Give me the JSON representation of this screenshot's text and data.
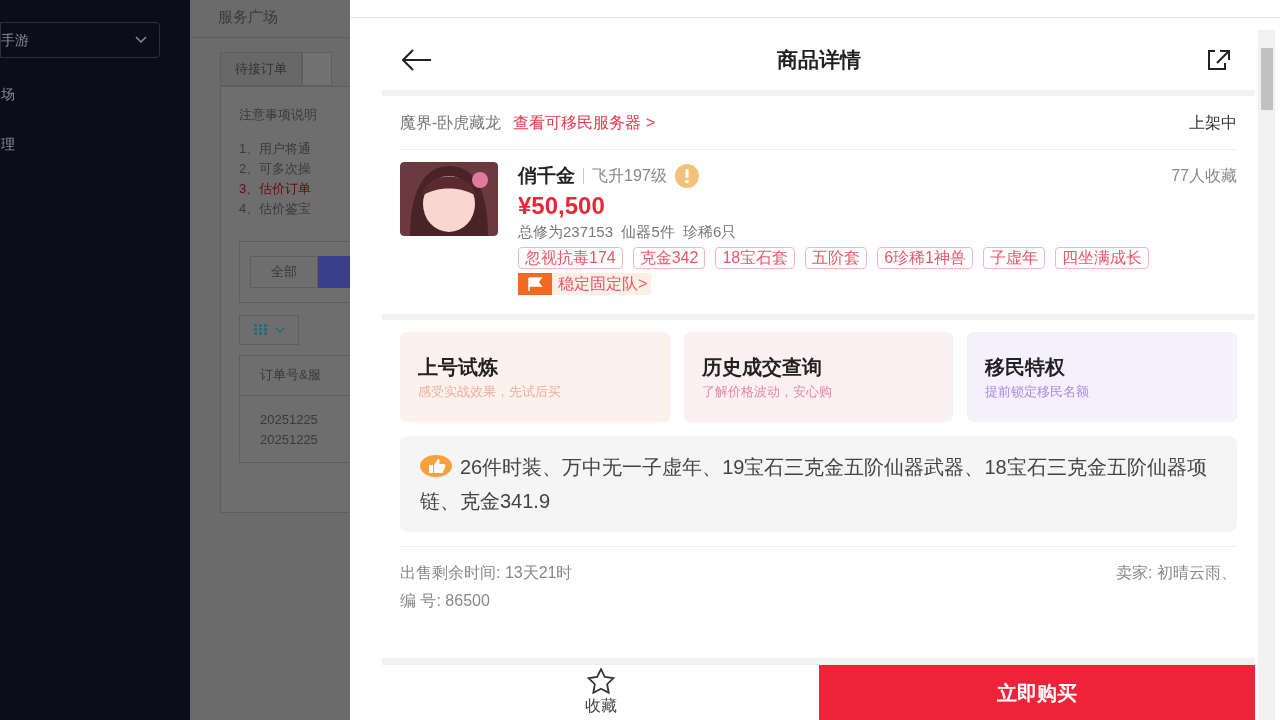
{
  "sidebar": {
    "select": {
      "value": "手游"
    },
    "items": [
      {
        "label": "场"
      },
      {
        "label": "理"
      }
    ]
  },
  "background_page": {
    "title": "服务广场",
    "tabs": [
      {
        "label": "待接订单",
        "selected": false
      }
    ],
    "notice_title": "注意事项说明",
    "notes": [
      {
        "text": "1、用户将通",
        "highlighted": false
      },
      {
        "text": "2、可多次操",
        "highlighted": false
      },
      {
        "text": "3、估价订单",
        "highlighted": true
      },
      {
        "text": "4、估价鉴宝",
        "highlighted": false
      }
    ],
    "filter_buttons": [
      {
        "label": "全部",
        "selected": false
      }
    ],
    "column_toggle": {
      "expanded": false
    },
    "table": {
      "columns": [
        "订单号&服"
      ],
      "rows": [
        "20251225",
        "20251225"
      ]
    }
  },
  "detail": {
    "title": "商品详情",
    "server": "魔界-卧虎藏龙",
    "server_link": "查看可移民服务器 >",
    "status": "上架中",
    "item": {
      "name": "俏千金",
      "level": "飞升197级",
      "favorites": "77人收藏",
      "price": "¥50,500",
      "stats": "总修为237153  仙器5件  珍稀6只",
      "tags": [
        "忽视抗毒174",
        "克金342",
        "18宝石套",
        "五阶套",
        "6珍稀1神兽",
        "子虚年",
        "四坐满成长"
      ],
      "team_badge": "稳定固定队>"
    },
    "cards": [
      {
        "title": "上号试炼",
        "subtitle": "感受实战效果，先试后买",
        "color": "#fdf1ee"
      },
      {
        "title": "历史成交查询",
        "subtitle": "了解价格波动，安心购",
        "color": "#fdf0f2"
      },
      {
        "title": "移民特权",
        "subtitle": "提前锁定移民名额",
        "color": "#f4f1fd"
      }
    ],
    "highlight": "26件时装、万中无一子虚年、19宝石三克金五阶仙器武器、18宝石三克金五阶仙器项链、克金341.9",
    "remaining": "出售剩余时间: 13天21时",
    "seller": "卖家: 初晴云雨、",
    "number": "编 号: 86500",
    "favorite_label": "收藏",
    "buy_label": "立即购买"
  }
}
